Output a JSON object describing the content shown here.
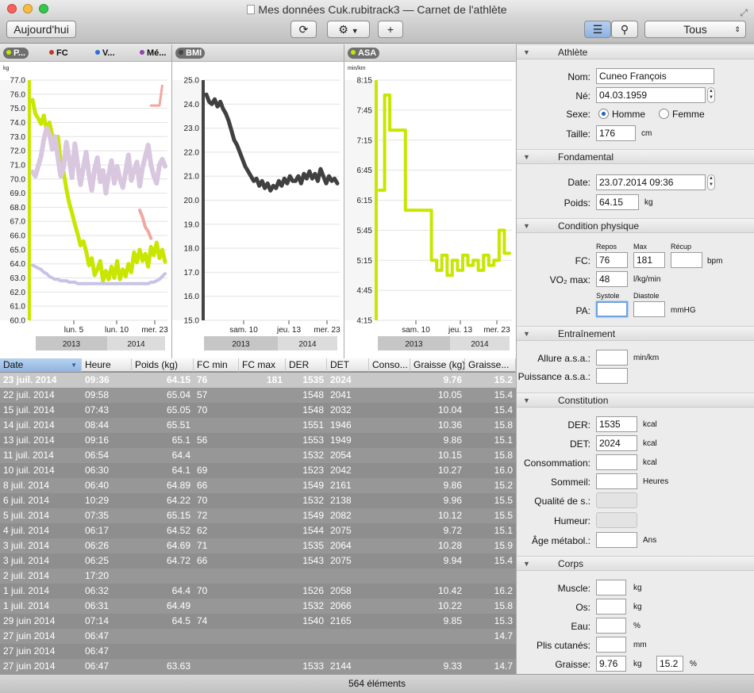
{
  "window": {
    "title": "Mes données Cuk.rubitrack3 — Carnet de l'athlète"
  },
  "toolbar": {
    "today_label": "Aujourd'hui",
    "filter_value": "Tous",
    "add_label": "+"
  },
  "charts": {
    "weight": {
      "pills": [
        {
          "label": "P...",
          "color": "#c8e600"
        },
        {
          "label": "FC",
          "color": "#c0392b"
        },
        {
          "label": "V...",
          "color": "#2f6fd6"
        },
        {
          "label": "Mé...",
          "color": "#8e44ad"
        }
      ],
      "unit": "kg",
      "yticks": [
        "77.0",
        "76.0",
        "75.0",
        "74.0",
        "73.0",
        "72.0",
        "71.0",
        "70.0",
        "69.0",
        "68.0",
        "67.0",
        "66.0",
        "65.0",
        "64.0",
        "63.0",
        "62.0",
        "61.0",
        "60.0"
      ],
      "ticks": [
        "lun. 5",
        "lun. 10",
        "mer. 23"
      ],
      "years": [
        "2013",
        "2014"
      ]
    },
    "bmi": {
      "pills": [
        {
          "label": "BMI",
          "color": "#444444"
        }
      ],
      "yticks": [
        "25.0",
        "24.0",
        "23.0",
        "22.0",
        "21.0",
        "20.0",
        "19.0",
        "18.0",
        "17.0",
        "16.0",
        "15.0"
      ],
      "ticks": [
        "sam. 10",
        "jeu. 13",
        "mer. 23"
      ],
      "years": [
        "2013",
        "2014"
      ]
    },
    "asa": {
      "pills": [
        {
          "label": "ASA",
          "color": "#c8e600"
        }
      ],
      "unit": "min/km",
      "yticks": [
        "8:15",
        "7:45",
        "7:15",
        "6:45",
        "6:15",
        "5:45",
        "5:15",
        "4:45",
        "4:15"
      ],
      "ticks": [
        "sam. 10",
        "jeu. 13",
        "mer. 23"
      ],
      "years": [
        "2013",
        "2014"
      ]
    }
  },
  "chart_data": [
    {
      "type": "line",
      "ylim": [
        60,
        77
      ],
      "ylabel": "kg",
      "series": [
        {
          "color": "#c8e600",
          "values": [
            75.6,
            74.6,
            74.3,
            73.9,
            74.5,
            73.4,
            74.0,
            73.1,
            72.6,
            73.0,
            71.2,
            70.5,
            69.3,
            68.3,
            67.6,
            66.8,
            66.1,
            65.3,
            65.6,
            64.9,
            63.9,
            64.4,
            63.2,
            63.6,
            64.2,
            62.8,
            63.5,
            62.9,
            63.8,
            63.0,
            64.2,
            62.9,
            63.6,
            63.1,
            64.0,
            63.4,
            64.8,
            64.1,
            65.0,
            64.2,
            64.7,
            63.8,
            65.2,
            64.6,
            65.5,
            64.4,
            65.0,
            64.15
          ]
        },
        {
          "color": "#d9c7e0",
          "values": [
            70.5,
            70.2,
            70.9,
            71.6,
            72.8,
            73.6,
            73.2,
            72.1,
            73.0,
            71.5,
            70.2,
            70.8,
            72.6,
            71.4,
            70.1,
            72.5,
            71.0,
            69.6,
            70.8,
            71.9,
            70.3,
            69.2,
            70.7,
            71.5,
            69.8,
            70.6,
            69.0,
            70.3,
            71.3,
            69.7,
            70.9,
            70.0,
            69.4,
            70.5,
            71.7,
            69.9,
            70.6,
            71.2,
            69.5,
            70.8,
            71.6,
            72.4,
            71.0,
            70.2,
            69.7,
            71.0,
            71.4,
            70.9
          ]
        },
        {
          "color": "#c8c2e8",
          "values": [
            63.9,
            63.8,
            63.7,
            63.6,
            63.4,
            63.3,
            63.1,
            63.0,
            62.9,
            62.9,
            62.8,
            62.8,
            62.8,
            62.7,
            62.7,
            62.7,
            62.6,
            62.6,
            62.6,
            62.6,
            62.6,
            62.6,
            62.6,
            62.6,
            62.6,
            62.6,
            62.6,
            62.6,
            62.6,
            62.6,
            62.6,
            62.6,
            62.6,
            62.6,
            62.6,
            62.6,
            62.6,
            62.6,
            62.6,
            62.6,
            62.6,
            62.6,
            62.7,
            62.7,
            62.8,
            62.9,
            63.1,
            63.3
          ]
        },
        {
          "color": "#f0a8a0",
          "values": [
            null,
            null,
            null,
            null,
            null,
            null,
            null,
            null,
            null,
            null,
            null,
            null,
            null,
            null,
            null,
            null,
            null,
            null,
            null,
            null,
            null,
            null,
            null,
            null,
            null,
            null,
            null,
            null,
            null,
            null,
            null,
            null,
            null,
            null,
            null,
            null,
            null,
            null,
            67.8,
            67.3,
            66.6,
            66.3,
            65.8,
            null,
            null,
            null,
            null,
            null
          ]
        },
        {
          "color": "#f0a8a0",
          "values": [
            null,
            null,
            null,
            null,
            null,
            null,
            null,
            null,
            null,
            null,
            null,
            null,
            null,
            null,
            null,
            null,
            null,
            null,
            null,
            null,
            null,
            null,
            null,
            null,
            null,
            null,
            null,
            null,
            null,
            null,
            null,
            null,
            null,
            null,
            null,
            null,
            null,
            null,
            null,
            null,
            null,
            null,
            75.2,
            75.2,
            75.2,
            75.2,
            76.6,
            null
          ]
        }
      ]
    },
    {
      "type": "line",
      "ylim": [
        15,
        25
      ],
      "series": [
        {
          "color": "#404040",
          "values": [
            24.4,
            24.1,
            24.0,
            24.2,
            23.9,
            24.1,
            23.8,
            23.6,
            23.3,
            22.9,
            22.5,
            22.3,
            22.0,
            21.7,
            21.4,
            21.2,
            21.0,
            20.8,
            20.9,
            20.6,
            20.8,
            20.5,
            20.7,
            20.4,
            20.6,
            20.5,
            20.8,
            20.6,
            20.9,
            20.7,
            21.0,
            20.8,
            20.8,
            21.0,
            20.7,
            21.1,
            20.9,
            21.2,
            20.9,
            21.1,
            20.8,
            21.3,
            21.0,
            20.7,
            21.0,
            20.8,
            20.9,
            20.7
          ]
        }
      ]
    },
    {
      "type": "line",
      "ylim": [
        "4:15",
        "8:15"
      ],
      "ylabel": "min/km",
      "series": [
        {
          "color": "#c8e600",
          "values": [
            "6:25",
            "8:00",
            "7:25",
            "7:25",
            "7:25",
            "6:05",
            "6:05",
            "6:05",
            "6:05",
            "6:05",
            "5:15",
            "5:05",
            "5:20",
            "5:00",
            "5:15",
            "5:05",
            "5:20",
            "5:10",
            "5:15",
            "5:05",
            "5:20",
            "5:10",
            "5:15",
            "5:45",
            "5:22",
            "5:22"
          ]
        }
      ]
    }
  ],
  "table": {
    "columns": [
      "Date",
      "Heure",
      "Poids (kg)",
      "FC min",
      "FC max",
      "DER",
      "DET",
      "Conso...",
      "Graisse (kg)",
      "Graisse..."
    ],
    "rows": [
      [
        "23 juil. 2014",
        "09:36",
        "64.15",
        "76",
        "181",
        "1535",
        "2024",
        "",
        "9.76",
        "15.2"
      ],
      [
        "22 juil. 2014",
        "09:58",
        "65.04",
        "57",
        "",
        "1548",
        "2041",
        "",
        "10.05",
        "15.4"
      ],
      [
        "15 juil. 2014",
        "07:43",
        "65.05",
        "70",
        "",
        "1548",
        "2032",
        "",
        "10.04",
        "15.4"
      ],
      [
        "14 juil. 2014",
        "08:44",
        "65.51",
        "",
        "",
        "1551",
        "1946",
        "",
        "10.36",
        "15.8"
      ],
      [
        "13 juil. 2014",
        "09:16",
        "65.1",
        "56",
        "",
        "1553",
        "1949",
        "",
        "9.86",
        "15.1"
      ],
      [
        "11 juil. 2014",
        "06:54",
        "64.4",
        "",
        "",
        "1532",
        "2054",
        "",
        "10.15",
        "15.8"
      ],
      [
        "10 juil. 2014",
        "06:30",
        "64.1",
        "69",
        "",
        "1523",
        "2042",
        "",
        "10.27",
        "16.0"
      ],
      [
        "8 juil. 2014",
        "06:40",
        "64.89",
        "66",
        "",
        "1549",
        "2161",
        "",
        "9.86",
        "15.2"
      ],
      [
        "6 juil. 2014",
        "10:29",
        "64.22",
        "70",
        "",
        "1532",
        "2138",
        "",
        "9.96",
        "15.5"
      ],
      [
        "5 juil. 2014",
        "07:35",
        "65.15",
        "72",
        "",
        "1549",
        "2082",
        "",
        "10.12",
        "15.5"
      ],
      [
        "4 juil. 2014",
        "06:17",
        "64.52",
        "62",
        "",
        "1544",
        "2075",
        "",
        "9.72",
        "15.1"
      ],
      [
        "3 juil. 2014",
        "06:26",
        "64.69",
        "71",
        "",
        "1535",
        "2064",
        "",
        "10.28",
        "15.9"
      ],
      [
        "3 juil. 2014",
        "06:25",
        "64.72",
        "66",
        "",
        "1543",
        "2075",
        "",
        "9.94",
        "15.4"
      ],
      [
        "2 juil. 2014",
        "17:20",
        "",
        "",
        "",
        "",
        "",
        "",
        "",
        ""
      ],
      [
        "1 juil. 2014",
        "06:32",
        "64.4",
        "70",
        "",
        "1526",
        "2058",
        "",
        "10.42",
        "16.2"
      ],
      [
        "1 juil. 2014",
        "06:31",
        "64.49",
        "",
        "",
        "1532",
        "2066",
        "",
        "10.22",
        "15.8"
      ],
      [
        "29 juin 2014",
        "07:14",
        "64.5",
        "74",
        "",
        "1540",
        "2165",
        "",
        "9.85",
        "15.3"
      ],
      [
        "27 juin 2014",
        "06:47",
        "",
        "",
        "",
        "",
        "",
        "",
        "",
        "14.7"
      ],
      [
        "27 juin 2014",
        "06:47",
        "",
        "",
        "",
        "",
        "",
        "",
        "",
        ""
      ],
      [
        "27 juin 2014",
        "06:47",
        "63.63",
        "",
        "",
        "1533",
        "2144",
        "",
        "9.33",
        "14.7"
      ]
    ]
  },
  "status": {
    "count": "564 éléments"
  },
  "panel": {
    "athlete": {
      "title": "Athlète",
      "name_label": "Nom:",
      "name": "Cuneo François",
      "born_label": "Né:",
      "born": "04.03.1959",
      "sex_label": "Sexe:",
      "male": "Homme",
      "female": "Femme",
      "height_label": "Taille:",
      "height": "176",
      "height_unit": "cm"
    },
    "fundamental": {
      "title": "Fondamental",
      "date_label": "Date:",
      "date": "23.07.2014 09:36",
      "weight_label": "Poids:",
      "weight": "64.15",
      "weight_unit": "kg"
    },
    "condition": {
      "title": "Condition physique",
      "rest": "Repos",
      "max": "Max",
      "recovery": "Récup",
      "hr_label": "FC:",
      "hr_rest": "76",
      "hr_max": "181",
      "hr_recovery": "",
      "hr_unit": "bpm",
      "vo2_label": "VO₂ max:",
      "vo2": "48",
      "vo2_unit": "l/kg/min",
      "systolic": "Systole",
      "diastolic": "Diastole",
      "bp_label": "PA:",
      "bp_unit": "mmHG"
    },
    "training": {
      "title": "Entraînement",
      "pace_label": "Allure a.s.a.:",
      "pace_unit": "min/km",
      "power_label": "Puissance a.s.a.:"
    },
    "constitution": {
      "title": "Constitution",
      "der_label": "DER:",
      "der": "1535",
      "der_unit": "kcal",
      "det_label": "DET:",
      "det": "2024",
      "det_unit": "kcal",
      "cons_label": "Consommation:",
      "cons_unit": "kcal",
      "sleep_label": "Sommeil:",
      "sleep_unit": "Heures",
      "sleep_quality_label": "Qualité de s.:",
      "mood_label": "Humeur:",
      "metabolic_label": "Âge métabol.:",
      "metabolic_unit": "Ans"
    },
    "body": {
      "title": "Corps",
      "muscle_label": "Muscle:",
      "muscle_unit": "kg",
      "bone_label": "Os:",
      "bone_unit": "kg",
      "water_label": "Eau:",
      "water_unit": "%",
      "skinfold_label": "Plis cutanés:",
      "skinfold_unit": "mm",
      "fat_label": "Graisse:",
      "fat_kg": "9.76",
      "fat_kg_unit": "kg",
      "fat_pct": "15.2",
      "fat_pct_unit": "%"
    }
  }
}
